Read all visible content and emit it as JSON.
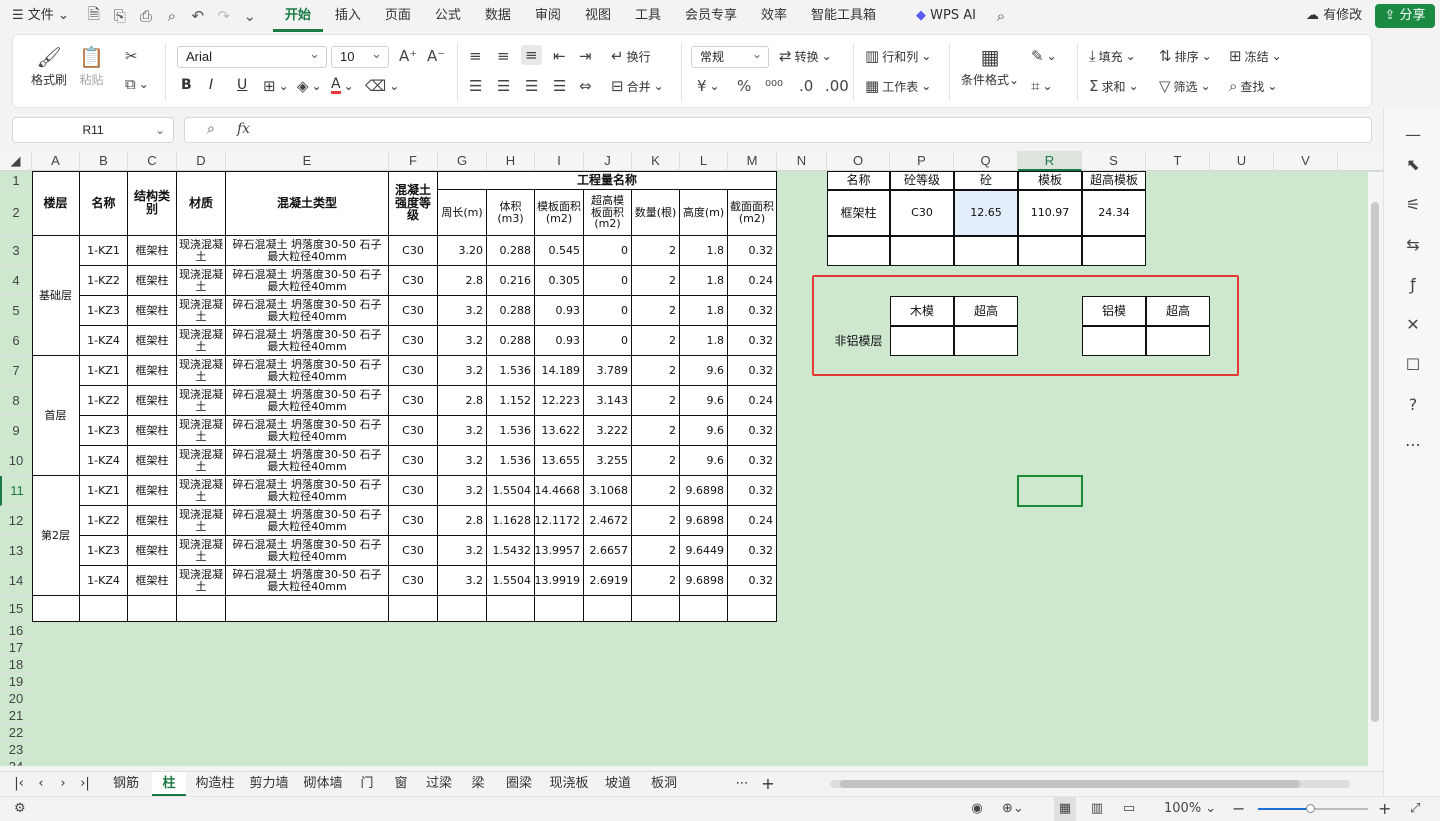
{
  "menu": {
    "file": "文件",
    "tabs": [
      "开始",
      "插入",
      "页面",
      "公式",
      "数据",
      "审阅",
      "视图",
      "工具",
      "会员专享",
      "效率",
      "智能工具箱"
    ],
    "active": "开始",
    "wps_ai": "WPS AI",
    "modified": "有修改",
    "share": "分享"
  },
  "ribbon": {
    "format_painter": "格式刷",
    "paste": "粘贴",
    "font": "Arial",
    "size": "10",
    "wrap": "换行",
    "merge": "合并",
    "number_format": "常规",
    "convert": "转换",
    "rows_cols": "行和列",
    "worksheet": "工作表",
    "cond_format": "条件格式",
    "fill": "填充",
    "sort": "排序",
    "freeze": "冻结",
    "sum": "求和",
    "filter": "筛选",
    "find": "查找"
  },
  "formula": {
    "cell_ref": "R11",
    "value": ""
  },
  "columns": [
    "A",
    "B",
    "C",
    "D",
    "E",
    "F",
    "G",
    "H",
    "I",
    "J",
    "K",
    "L",
    "M",
    "N",
    "O",
    "P",
    "Q",
    "R",
    "S",
    "T",
    "U",
    "V"
  ],
  "selected_col": "R",
  "selected_row": "11",
  "rows": [
    "1",
    "2",
    "3",
    "4",
    "5",
    "6",
    "7",
    "8",
    "9",
    "10",
    "11",
    "12",
    "13",
    "14",
    "15",
    "16",
    "17",
    "18",
    "19",
    "20",
    "21",
    "22",
    "23",
    "24"
  ],
  "table": {
    "h_floor": "楼层",
    "h_name": "名称",
    "h_struct": "结构类别",
    "h_material": "材质",
    "h_concrete": "混凝土类型",
    "h_grade": "混凝土强度等级",
    "h_qty_title": "工程量名称",
    "sub": [
      "周长(m)",
      "体积(m3)",
      "模板面积(m2)",
      "超高模板面积(m2)",
      "数量(根)",
      "高度(m)",
      "截面面积(m2)"
    ],
    "floors": [
      "基础层",
      "首层",
      "第2层"
    ],
    "body": [
      [
        "1-KZ1",
        "框架柱",
        "现浇混凝土",
        "碎石混凝土 坍落度30-50 石子最大粒径40mm",
        "C30",
        "3.20",
        "0.288",
        "0.545",
        "0",
        "2",
        "1.8",
        "0.32"
      ],
      [
        "1-KZ2",
        "框架柱",
        "现浇混凝土",
        "碎石混凝土 坍落度30-50 石子最大粒径40mm",
        "C30",
        "2.8",
        "0.216",
        "0.305",
        "0",
        "2",
        "1.8",
        "0.24"
      ],
      [
        "1-KZ3",
        "框架柱",
        "现浇混凝土",
        "碎石混凝土 坍落度30-50 石子最大粒径40mm",
        "C30",
        "3.2",
        "0.288",
        "0.93",
        "0",
        "2",
        "1.8",
        "0.32"
      ],
      [
        "1-KZ4",
        "框架柱",
        "现浇混凝土",
        "碎石混凝土 坍落度30-50 石子最大粒径40mm",
        "C30",
        "3.2",
        "0.288",
        "0.93",
        "0",
        "2",
        "1.8",
        "0.32"
      ],
      [
        "1-KZ1",
        "框架柱",
        "现浇混凝土",
        "碎石混凝土 坍落度30-50 石子最大粒径40mm",
        "C30",
        "3.2",
        "1.536",
        "14.189",
        "3.789",
        "2",
        "9.6",
        "0.32"
      ],
      [
        "1-KZ2",
        "框架柱",
        "现浇混凝土",
        "碎石混凝土 坍落度30-50 石子最大粒径40mm",
        "C30",
        "2.8",
        "1.152",
        "12.223",
        "3.143",
        "2",
        "9.6",
        "0.24"
      ],
      [
        "1-KZ3",
        "框架柱",
        "现浇混凝土",
        "碎石混凝土 坍落度30-50 石子最大粒径40mm",
        "C30",
        "3.2",
        "1.536",
        "13.622",
        "3.222",
        "2",
        "9.6",
        "0.32"
      ],
      [
        "1-KZ4",
        "框架柱",
        "现浇混凝土",
        "碎石混凝土 坍落度30-50 石子最大粒径40mm",
        "C30",
        "3.2",
        "1.536",
        "13.655",
        "3.255",
        "2",
        "9.6",
        "0.32"
      ],
      [
        "1-KZ1",
        "框架柱",
        "现浇混凝土",
        "碎石混凝土 坍落度30-50 石子最大粒径40mm",
        "C30",
        "3.2",
        "1.5504",
        "14.4668",
        "3.1068",
        "2",
        "9.6898",
        "0.32"
      ],
      [
        "1-KZ2",
        "框架柱",
        "现浇混凝土",
        "碎石混凝土 坍落度30-50 石子最大粒径40mm",
        "C30",
        "2.8",
        "1.1628",
        "12.1172",
        "2.4672",
        "2",
        "9.6898",
        "0.24"
      ],
      [
        "1-KZ3",
        "框架柱",
        "现浇混凝土",
        "碎石混凝土 坍落度30-50 石子最大粒径40mm",
        "C30",
        "3.2",
        "1.5432",
        "13.9957",
        "2.6657",
        "2",
        "9.6449",
        "0.32"
      ],
      [
        "1-KZ4",
        "框架柱",
        "现浇混凝土",
        "碎石混凝土 坍落度30-50 石子最大粒径40mm",
        "C30",
        "3.2",
        "1.5504",
        "13.9919",
        "2.6919",
        "2",
        "9.6898",
        "0.32"
      ]
    ]
  },
  "summary": {
    "headers": [
      "名称",
      "砼等级",
      "砼",
      "模板",
      "超高模板"
    ],
    "row": [
      "框架柱",
      "C30",
      "12.65",
      "110.97",
      "24.34"
    ]
  },
  "box": {
    "label": "非铝模层",
    "wood": "木模",
    "over1": "超高",
    "alu": "铝模",
    "over2": "超高"
  },
  "sheets": [
    "钢筋",
    "柱",
    "构造柱",
    "剪力墙",
    "砌体墙",
    "门",
    "窗",
    "过梁",
    "梁",
    "圈梁",
    "现浇板",
    "坡道",
    "板洞"
  ],
  "active_sheet": "柱",
  "status": {
    "zoom": "100%"
  },
  "colors": {
    "accent": "#1b7a43",
    "grid_bg": "#cee8d0",
    "red": "#e53935"
  }
}
